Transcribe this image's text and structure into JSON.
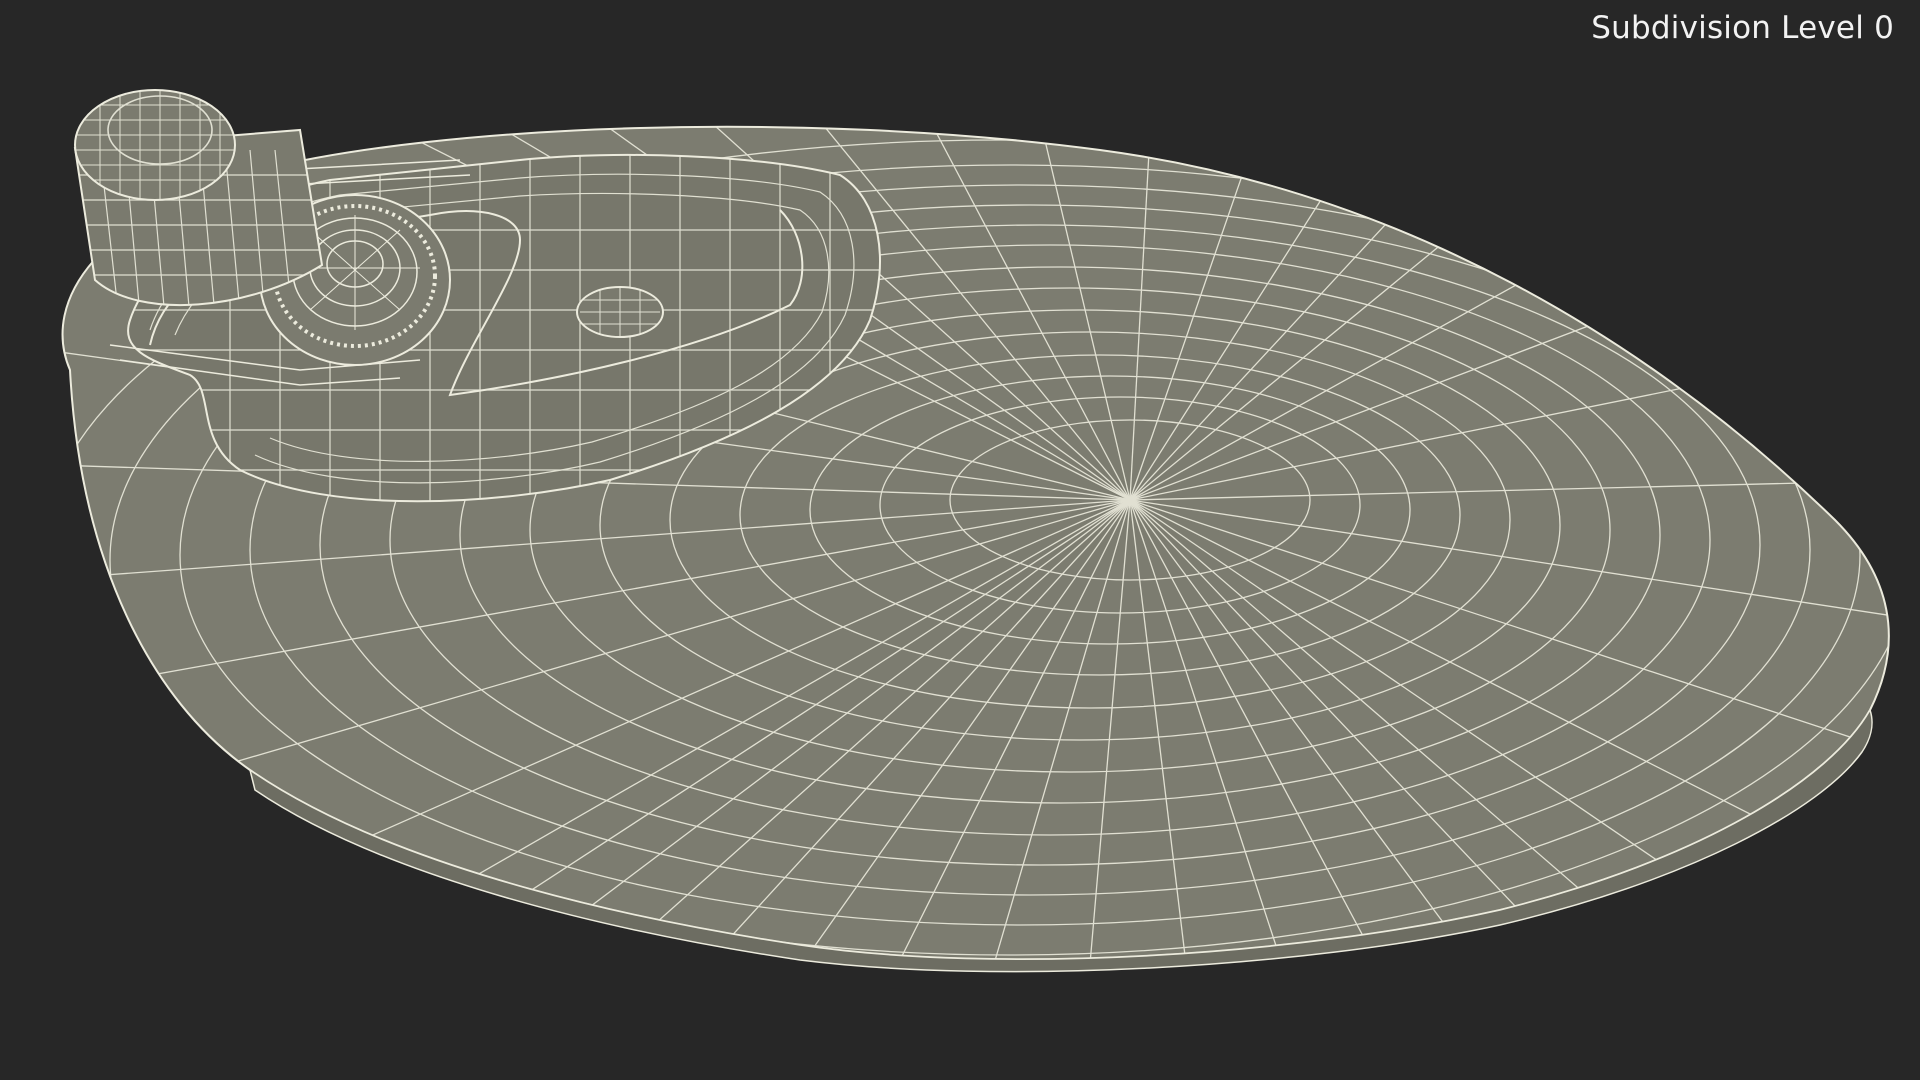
{
  "viewport": {
    "label": "Subdivision Level 0",
    "background_color": "#272727",
    "model_fill_color": "#7b7b6f",
    "wire_color": "#ecebdd"
  },
  "model": {
    "description_name": "wireframe-mouse-mesh"
  }
}
